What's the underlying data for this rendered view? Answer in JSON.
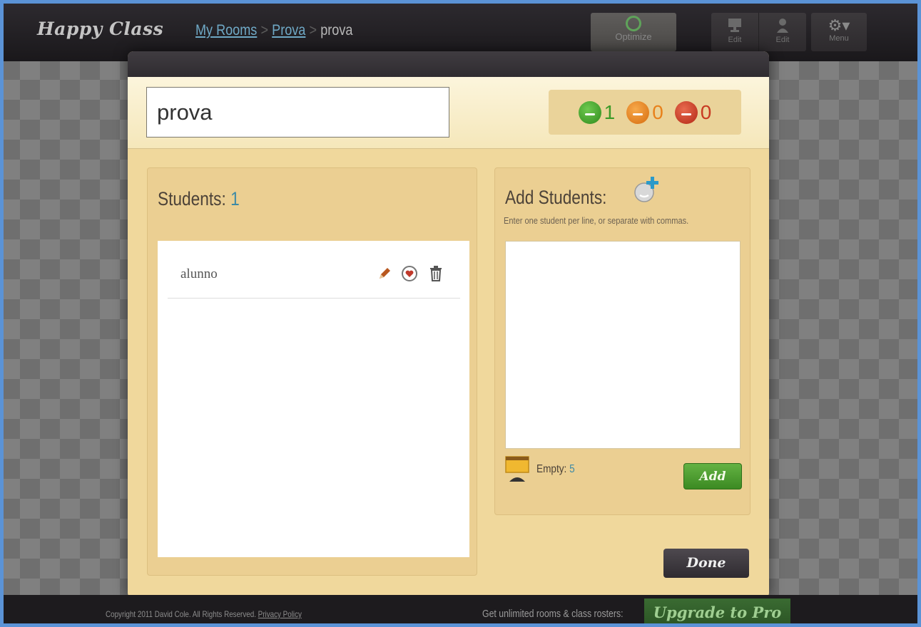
{
  "app": {
    "logo": "Happy Class"
  },
  "breadcrumb": {
    "items": [
      "My Rooms",
      "Prova"
    ],
    "separator": ">",
    "current": "prova"
  },
  "toolbar": {
    "optimize_label": "Optimize",
    "edit_desk_label": "Edit",
    "edit_student_label": "Edit",
    "menu_label": "Menu"
  },
  "room": {
    "name_value": "prova",
    "moods": {
      "happy": {
        "count": "1",
        "color": "#3c9a28"
      },
      "neutral": {
        "count": "0",
        "color": "#e8811b"
      },
      "sad": {
        "count": "0",
        "color": "#c83a22"
      }
    }
  },
  "students_panel": {
    "title": "Students:",
    "count": "1",
    "students": [
      {
        "name": "alunno",
        "actions": [
          "pencil-icon",
          "heart-icon",
          "trash-icon"
        ]
      }
    ]
  },
  "add_panel": {
    "title": "Add Students:",
    "hint": "Enter one student per line, or separate with commas.",
    "textarea_value": "",
    "empty_label": "Empty:",
    "empty_count": "5",
    "add_button": "Add"
  },
  "done_button": "Done",
  "footer": {
    "copyright": "Copyright 2011 David Cole. All Rights Reserved.",
    "privacy_link": "Privacy Policy",
    "promo_text": "Get unlimited rooms & class rosters:",
    "upgrade_label": "Upgrade to Pro"
  },
  "colors": {
    "accent_blue": "#3c8aa6",
    "modal_bg": "#f0d89c",
    "add_green": "#4a9c2c",
    "topbar": "#1e1c1f"
  }
}
